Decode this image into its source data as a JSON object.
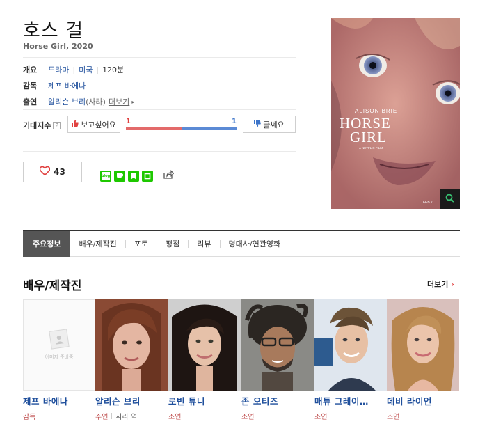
{
  "movie": {
    "title": "호스 걸",
    "subtitle": "Horse Girl, 2020"
  },
  "info": {
    "overview_label": "개요",
    "genre": "드라마",
    "country": "미국",
    "runtime": "120분",
    "director_label": "감독",
    "director": "제프 바에나",
    "cast_label": "출연",
    "cast_main": "알리슨 브리",
    "cast_role": "(사라)",
    "more": "더보기",
    "more_arrow": "▸"
  },
  "expectation": {
    "label": "기대지수",
    "help": "?",
    "want_button": "보고싶어요",
    "meh_button": "글쎄요",
    "want_count": "1",
    "meh_count": "1",
    "want_ratio": 0.5
  },
  "like": {
    "count": "43"
  },
  "share": {
    "blog_label": "blog"
  },
  "poster": {
    "actor": "ALISON BRIE",
    "line1": "HORSE",
    "line2": "GIRL",
    "tagline": "A NETFLIX FILM",
    "date": "FEB 7"
  },
  "tabs": [
    {
      "label": "주요정보"
    },
    {
      "label": "배우/제작진"
    },
    {
      "label": "포토"
    },
    {
      "label": "평점"
    },
    {
      "label": "리뷰"
    },
    {
      "label": "명대사/연관영화"
    }
  ],
  "cast_section": {
    "title": "배우/제작진",
    "more": "더보기",
    "more_arrow": "›",
    "noimage_text": "이미지 준비중",
    "people": [
      {
        "name": "제프 바에나",
        "role": "감독",
        "character": ""
      },
      {
        "name": "알리슨 브리",
        "role": "주연",
        "character": "사라 역"
      },
      {
        "name": "로빈 튜니",
        "role": "조연",
        "character": ""
      },
      {
        "name": "존 오티즈",
        "role": "조연",
        "character": ""
      },
      {
        "name": "매튜 그레이…",
        "role": "조연",
        "character": ""
      },
      {
        "name": "데비 라이언",
        "role": "조연",
        "character": ""
      }
    ]
  },
  "colors": {
    "link_blue": "#1f4f9c",
    "accent_red": "#e0403f",
    "gauge_red": "#e36a6a",
    "gauge_blue": "#5b8ad5",
    "naver_green": "#1ec800"
  }
}
